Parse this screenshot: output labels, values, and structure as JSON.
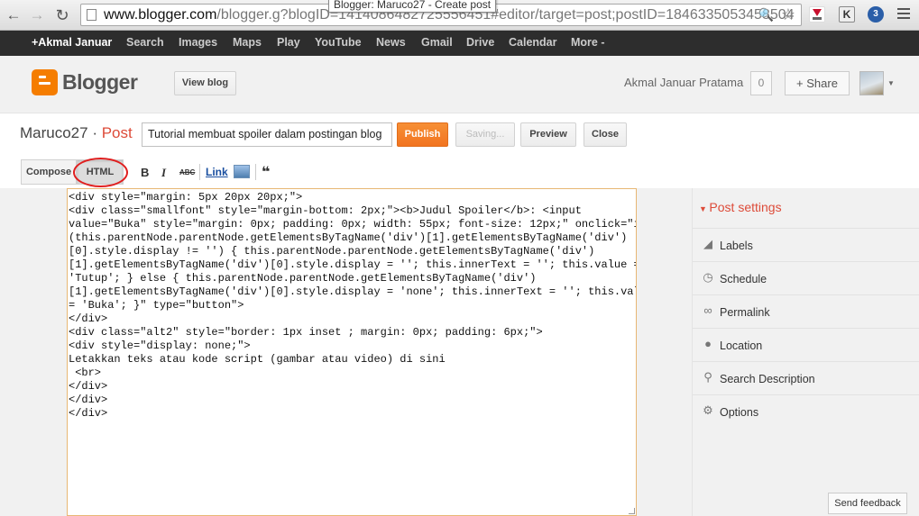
{
  "browser": {
    "tooltip": "Blogger: Maruco27 - Create post",
    "url_host": "www.blogger.com",
    "url_rest": "/blogger.g?blogID=1414086482725556451#editor/target=post;postID=1846335053458504",
    "back_icon": "back-arrow-icon",
    "forward_icon": "forward-arrow-icon",
    "reload_icon": "reload-icon"
  },
  "gbar": {
    "items": [
      "+Akmal Januar",
      "Search",
      "Images",
      "Maps",
      "Play",
      "YouTube",
      "News",
      "Gmail",
      "Drive",
      "Calendar",
      "More -"
    ]
  },
  "header": {
    "logo_text": "Blogger",
    "view_blog": "View blog",
    "user_name": "Akmal Januar Pratama",
    "notification_count": "0",
    "share": "Share"
  },
  "post": {
    "blog_name": "Maruco27",
    "separator": " · ",
    "post_word": "Post",
    "title_value": "Tutorial membuat spoiler dalam postingan blog",
    "publish": "Publish",
    "saving": "Saving...",
    "preview": "Preview",
    "close": "Close"
  },
  "toolbar": {
    "compose": "Compose",
    "html": "HTML",
    "bold": "B",
    "italic": "I",
    "strike": "ABC",
    "link": "Link",
    "quote": "❝"
  },
  "editor": {
    "lines": [
      "<div style=\"margin: 5px 20px 20px;\">",
      "<div class=\"smallfont\" style=\"margin-bottom: 2px;\"><b>Judul Spoiler</b>: <input",
      "value=\"Buka\" style=\"margin: 0px; padding: 0px; width: 55px; font-size: 12px;\" onclick=\"if",
      "(this.parentNode.parentNode.getElementsByTagName('div')[1].getElementsByTagName('div')",
      "[0].style.display != '') { this.parentNode.parentNode.getElementsByTagName('div')",
      "[1].getElementsByTagName('div')[0].style.display = ''; this.innerText = ''; this.value =",
      "'Tutup'; } else { this.parentNode.parentNode.getElementsByTagName('div')",
      "[1].getElementsByTagName('div')[0].style.display = 'none'; this.innerText = ''; this.value",
      "= 'Buka'; }\" type=\"button\">",
      "</div>",
      "<div class=\"alt2\" style=\"border: 1px inset ; margin: 0px; padding: 6px;\">",
      "<div style=\"display: none;\">",
      "Letakkan teks atau kode script (gambar atau video) di sini",
      " <br>",
      "</div>",
      "</div>",
      "</div>"
    ]
  },
  "sidebar": {
    "heading": "Post settings",
    "items": [
      {
        "label": "Labels",
        "icon": "label-tag-icon"
      },
      {
        "label": "Schedule",
        "icon": "clock-icon"
      },
      {
        "label": "Permalink",
        "icon": "link-chain-icon"
      },
      {
        "label": "Location",
        "icon": "location-pin-icon"
      },
      {
        "label": "Search Description",
        "icon": "search-icon"
      },
      {
        "label": "Options",
        "icon": "gear-icon"
      }
    ]
  },
  "feedback": "Send feedback",
  "colors": {
    "accent_orange": "#f57d00",
    "post_red": "#dd4b39",
    "highlight_circle": "#e01f1f"
  }
}
